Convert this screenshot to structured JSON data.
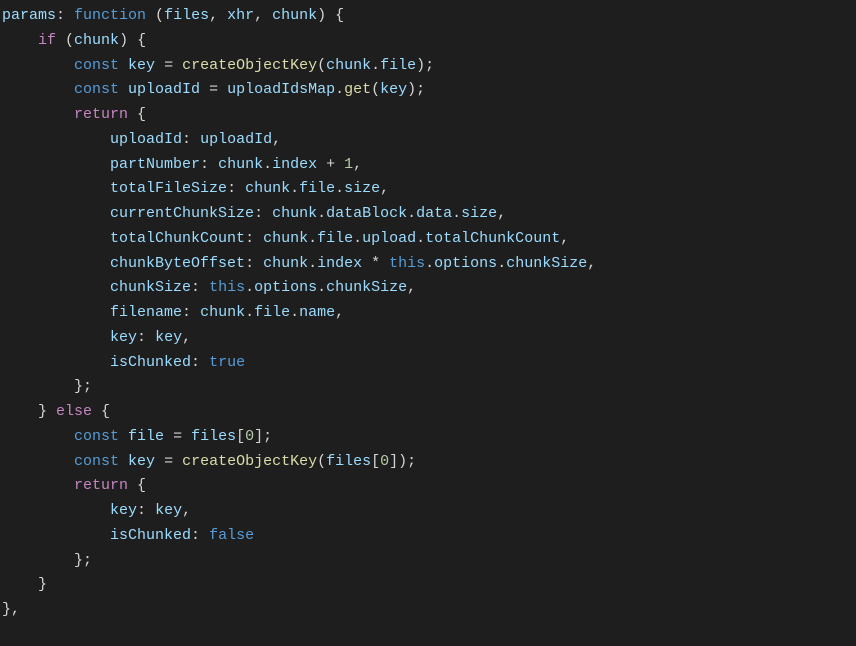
{
  "line1": {
    "t1": "params",
    "t2": ": ",
    "t3": "function",
    "t4": " (",
    "t5": "files",
    "t6": ", ",
    "t7": "xhr",
    "t8": ", ",
    "t9": "chunk",
    "t10": ") {"
  },
  "line2": {
    "t1": "    ",
    "t2": "if",
    "t3": " (",
    "t4": "chunk",
    "t5": ") {"
  },
  "line3": {
    "t1": "        ",
    "t2": "const",
    "t3": " ",
    "t4": "key",
    "t5": " = ",
    "t6": "createObjectKey",
    "t7": "(",
    "t8": "chunk",
    "t9": ".",
    "t10": "file",
    "t11": ");"
  },
  "line4": {
    "t1": "        ",
    "t2": "const",
    "t3": " ",
    "t4": "uploadId",
    "t5": " = ",
    "t6": "uploadIdsMap",
    "t7": ".",
    "t8": "get",
    "t9": "(",
    "t10": "key",
    "t11": ");"
  },
  "line5": {
    "t1": "        ",
    "t2": "return",
    "t3": " {"
  },
  "line6": {
    "t1": "            ",
    "t2": "uploadId",
    "t3": ": ",
    "t4": "uploadId",
    "t5": ","
  },
  "line7": {
    "t1": "            ",
    "t2": "partNumber",
    "t3": ": ",
    "t4": "chunk",
    "t5": ".",
    "t6": "index",
    "t7": " + ",
    "t8": "1",
    "t9": ","
  },
  "line8": {
    "t1": "            ",
    "t2": "totalFileSize",
    "t3": ": ",
    "t4": "chunk",
    "t5": ".",
    "t6": "file",
    "t7": ".",
    "t8": "size",
    "t9": ","
  },
  "line9": {
    "t1": "            ",
    "t2": "currentChunkSize",
    "t3": ": ",
    "t4": "chunk",
    "t5": ".",
    "t6": "dataBlock",
    "t7": ".",
    "t8": "data",
    "t9": ".",
    "t10": "size",
    "t11": ","
  },
  "line10": {
    "t1": "            ",
    "t2": "totalChunkCount",
    "t3": ": ",
    "t4": "chunk",
    "t5": ".",
    "t6": "file",
    "t7": ".",
    "t8": "upload",
    "t9": ".",
    "t10": "totalChunkCount",
    "t11": ","
  },
  "line11": {
    "t1": "            ",
    "t2": "chunkByteOffset",
    "t3": ": ",
    "t4": "chunk",
    "t5": ".",
    "t6": "index",
    "t7": " * ",
    "t8": "this",
    "t9": ".",
    "t10": "options",
    "t11": ".",
    "t12": "chunkSize",
    "t13": ","
  },
  "line12": {
    "t1": "            ",
    "t2": "chunkSize",
    "t3": ": ",
    "t4": "this",
    "t5": ".",
    "t6": "options",
    "t7": ".",
    "t8": "chunkSize",
    "t9": ","
  },
  "line13": {
    "t1": "            ",
    "t2": "filename",
    "t3": ": ",
    "t4": "chunk",
    "t5": ".",
    "t6": "file",
    "t7": ".",
    "t8": "name",
    "t9": ","
  },
  "line14": {
    "t1": "            ",
    "t2": "key",
    "t3": ": ",
    "t4": "key",
    "t5": ","
  },
  "line15": {
    "t1": "            ",
    "t2": "isChunked",
    "t3": ": ",
    "t4": "true"
  },
  "line16": {
    "t1": "        };"
  },
  "line17": {
    "t1": "    } ",
    "t2": "else",
    "t3": " {"
  },
  "line18": {
    "t1": "        ",
    "t2": "const",
    "t3": " ",
    "t4": "file",
    "t5": " = ",
    "t6": "files",
    "t7": "[",
    "t8": "0",
    "t9": "];"
  },
  "line19": {
    "t1": "        ",
    "t2": "const",
    "t3": " ",
    "t4": "key",
    "t5": " = ",
    "t6": "createObjectKey",
    "t7": "(",
    "t8": "files",
    "t9": "[",
    "t10": "0",
    "t11": "]);"
  },
  "line20": {
    "t1": "        ",
    "t2": "return",
    "t3": " {"
  },
  "line21": {
    "t1": "            ",
    "t2": "key",
    "t3": ": ",
    "t4": "key",
    "t5": ","
  },
  "line22": {
    "t1": "            ",
    "t2": "isChunked",
    "t3": ": ",
    "t4": "false"
  },
  "line23": {
    "t1": "        };"
  },
  "line24": {
    "t1": "    }"
  },
  "line25": {
    "t1": "},"
  }
}
